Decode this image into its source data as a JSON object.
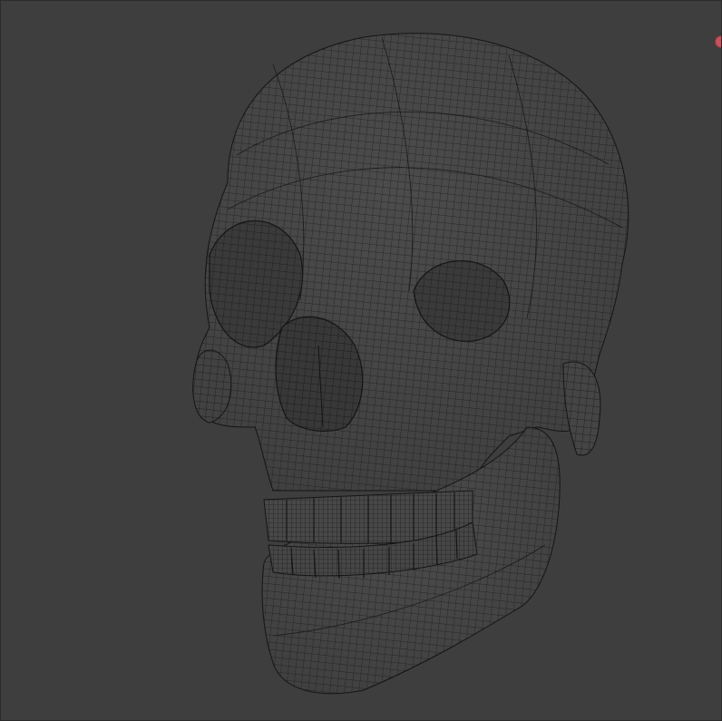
{
  "viewport": {
    "background": "#3e3e3e",
    "mesh_fill": "#474747",
    "wire_color": "#141414",
    "shade_color": "#2b2b2b",
    "shading": "wireframe-on-shaded"
  },
  "model": {
    "subject": "human skull",
    "mesh_type": "quad wireframe"
  },
  "marker": {
    "icon": "record-dot-icon",
    "color": "#c8505e"
  }
}
